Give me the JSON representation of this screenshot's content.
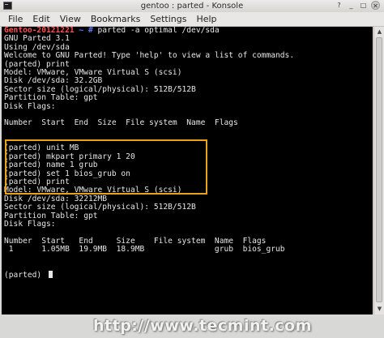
{
  "window": {
    "title": "gentoo : parted - Konsole",
    "icon": "terminal-icon"
  },
  "menu": {
    "items": [
      {
        "label": "File"
      },
      {
        "label": "Edit"
      },
      {
        "label": "View"
      },
      {
        "label": "Bookmarks"
      },
      {
        "label": "Settings"
      },
      {
        "label": "Help"
      }
    ]
  },
  "terminal": {
    "prompt_host": "Gentoo-20121221",
    "prompt_path": "~ #",
    "prompt_command": " parted -a optimal /dev/sda",
    "lines": [
      "GNU Parted 3.1",
      "Using /dev/sda",
      "Welcome to GNU Parted! Type 'help' to view a list of commands.",
      "(parted) print",
      "Model: VMware, VMware Virtual S (scsi)",
      "Disk /dev/sda: 32.2GB",
      "Sector size (logical/physical): 512B/512B",
      "Partition Table: gpt",
      "Disk Flags:",
      "",
      "Number  Start  End  Size  File system  Name  Flags",
      "",
      "",
      "(parted) unit MB",
      "(parted) mkpart primary 1 20",
      "(parted) name 1 grub",
      "(parted) set 1 bios_grub on",
      "(parted) print",
      "Model: VMware, VMware Virtual S (scsi)",
      "Disk /dev/sda: 32212MB",
      "Sector size (logical/physical): 512B/512B",
      "Partition Table: gpt",
      "Disk Flags:",
      "",
      "Number  Start   End     Size    File system  Name  Flags",
      " 1      1.05MB  19.9MB  18.9MB               grub  bios_grub",
      "",
      "",
      "(parted) "
    ]
  },
  "watermark": "http://www.tecmint.com",
  "colors": {
    "terminal_bg": "#000000",
    "terminal_fg": "#e6e6e6",
    "prompt_user": "#ff5050",
    "prompt_path": "#5a7bff",
    "highlight_box": "#e8a417"
  }
}
